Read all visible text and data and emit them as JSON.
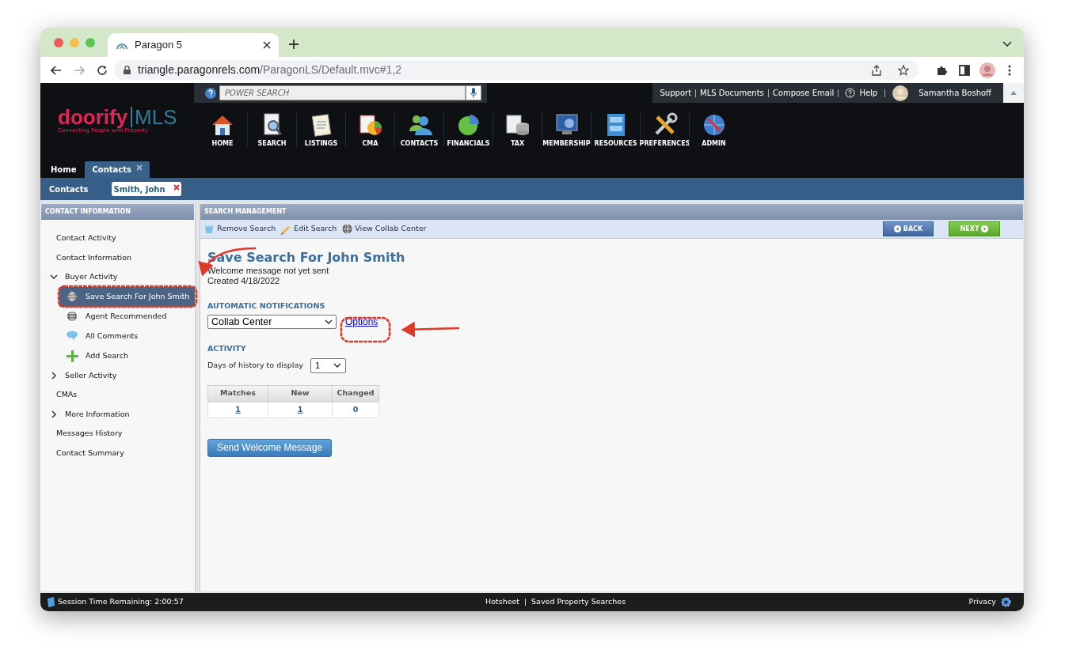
{
  "browser": {
    "tab_title": "Paragon 5",
    "url": {
      "host": "triangle.paragonrels.com",
      "path": "/ParagonLS/Default.mvc#1,2"
    }
  },
  "header": {
    "logo": {
      "brand": "doorify",
      "suffix": "MLS",
      "tagline": "Connecting People with Property"
    },
    "search_placeholder": "POWER SEARCH",
    "links": [
      "Support",
      "MLS Documents",
      "Compose Email"
    ],
    "help": "Help",
    "user_name": "Samantha Boshoff",
    "nav": [
      "HOME",
      "SEARCH",
      "LISTINGS",
      "CMA",
      "CONTACTS",
      "FINANCIALS",
      "TAX",
      "MEMBERSHIP",
      "RESOURCES",
      "PREFERENCES",
      "ADMIN"
    ]
  },
  "tabs": [
    {
      "label": "Home",
      "selected": false,
      "closable": false
    },
    {
      "label": "Contacts",
      "selected": true,
      "closable": true
    }
  ],
  "subtabs": {
    "label": "Contacts",
    "open_record": "Smith, John"
  },
  "sidebar": {
    "title": "CONTACT INFORMATION",
    "items": [
      {
        "label": "Contact Activity",
        "kind": "link",
        "selected": false
      },
      {
        "label": "Contact Information",
        "kind": "link",
        "selected": false
      },
      {
        "label": "Buyer Activity",
        "kind": "group",
        "expanded": true,
        "selected": false,
        "children": [
          {
            "label": "Save Search For John Smith",
            "selected": true
          },
          {
            "label": "Agent Recommended",
            "selected": false
          },
          {
            "label": "All Comments",
            "selected": false
          },
          {
            "label": "Add Search",
            "selected": false
          }
        ]
      },
      {
        "label": "Seller Activity",
        "kind": "group",
        "expanded": false,
        "selected": false
      },
      {
        "label": "CMAs",
        "kind": "link",
        "selected": false
      },
      {
        "label": "More Information",
        "kind": "group",
        "expanded": false,
        "selected": false
      },
      {
        "label": "Messages History",
        "kind": "link",
        "selected": false
      },
      {
        "label": "Contact Summary",
        "kind": "link",
        "selected": false
      }
    ]
  },
  "main": {
    "title": "SEARCH MANAGEMENT",
    "actions": [
      "Remove Search",
      "Edit Search",
      "View Collab Center"
    ],
    "back": "BACK",
    "next": "NEXT",
    "heading": "Save Search For John Smith",
    "status_lines": [
      "Welcome message not yet sent",
      "Created 4/18/2022"
    ],
    "notifications": {
      "label": "AUTOMATIC NOTIFICATIONS",
      "value": "Collab Center",
      "link": "Options"
    },
    "activity": {
      "label": "ACTIVITY",
      "days_label": "Days of history to display",
      "days_value": "1",
      "columns": [
        "Matches",
        "New",
        "Changed"
      ],
      "row": [
        {
          "text": "1",
          "link": true
        },
        {
          "text": "1",
          "link": true
        },
        {
          "text": "0",
          "link": false
        }
      ]
    },
    "send_button": "Send Welcome Message"
  },
  "status_bar": {
    "session": "Session Time Remaining: 2:00:57",
    "links": [
      "Hotsheet",
      "Saved Property Searches"
    ],
    "privacy": "Privacy"
  }
}
